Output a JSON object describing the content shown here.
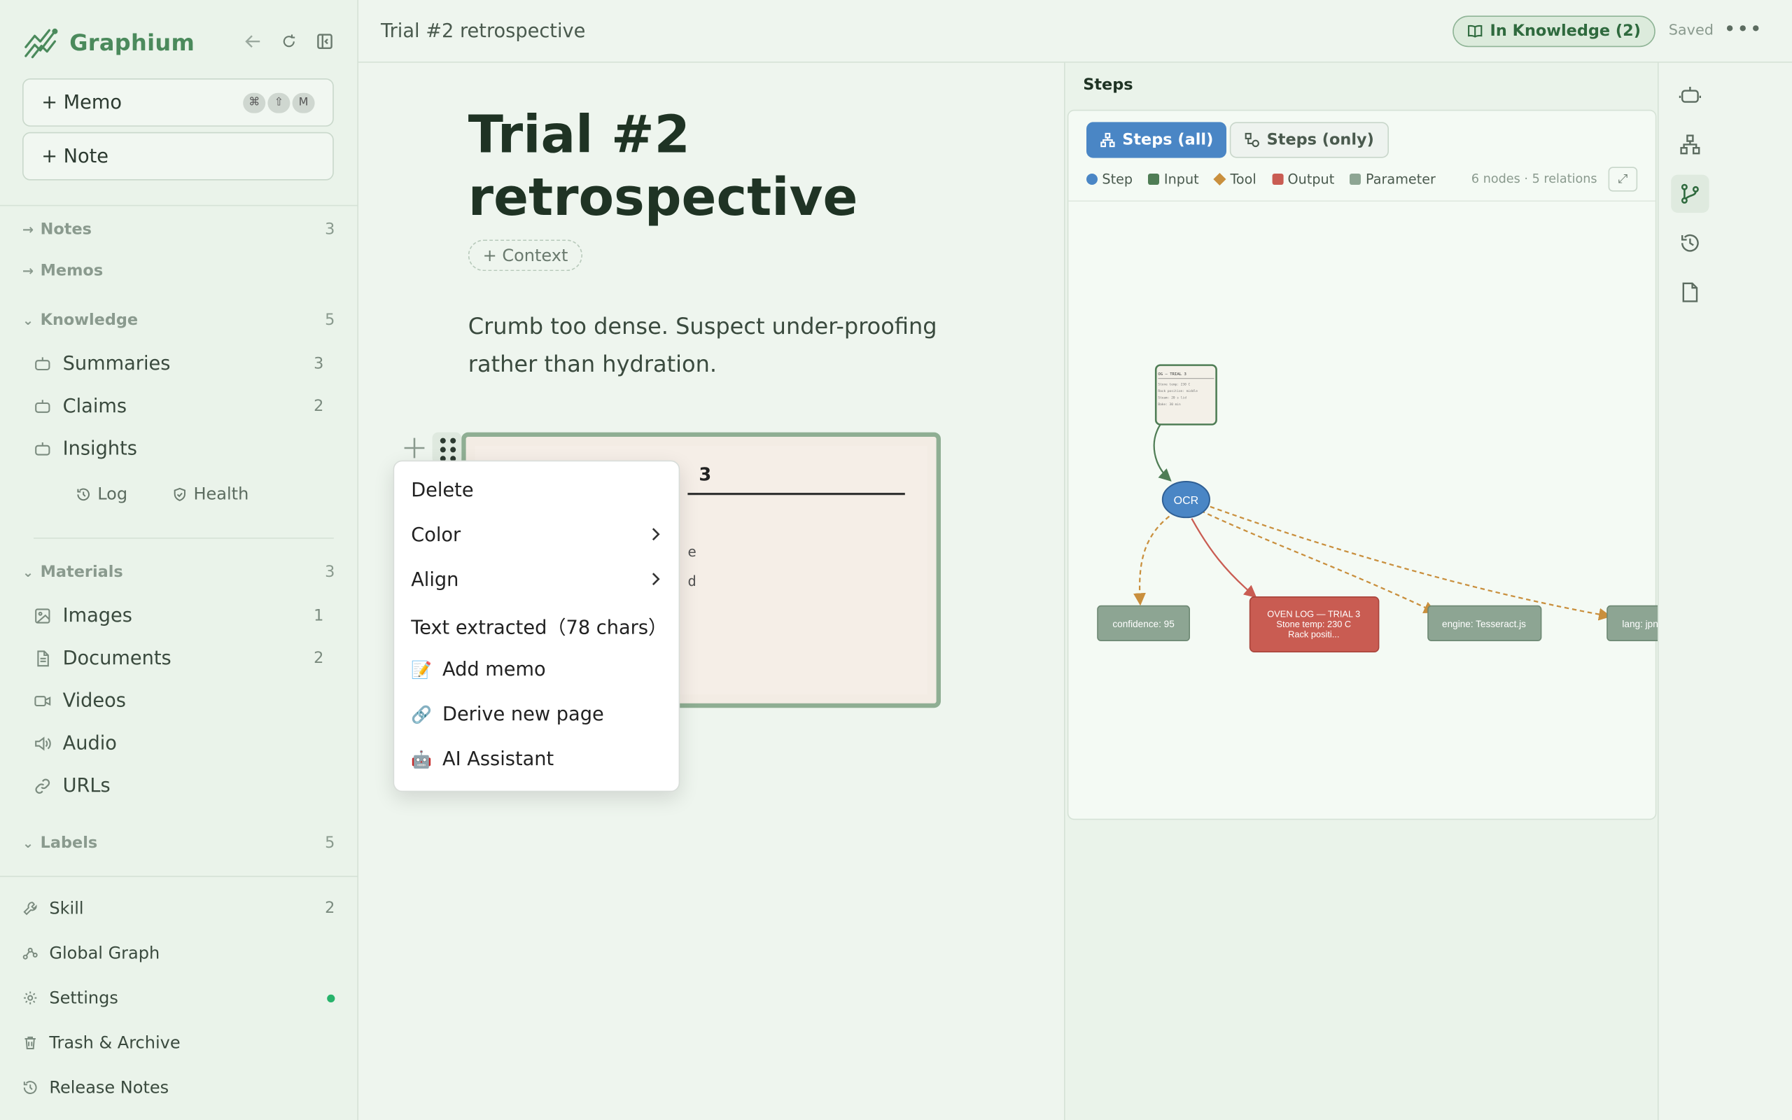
{
  "app": {
    "name": "Graphium"
  },
  "sidebar": {
    "create": [
      {
        "label": "+ Memo",
        "shortcut": [
          "⌘",
          "⇧",
          "M"
        ]
      },
      {
        "label": "+ Note"
      }
    ],
    "notes": {
      "label": "Notes",
      "count": "3"
    },
    "memos": {
      "label": "Memos"
    },
    "knowledge": {
      "label": "Knowledge",
      "count": "5",
      "items": [
        {
          "label": "Summaries",
          "count": "3"
        },
        {
          "label": "Claims",
          "count": "2"
        },
        {
          "label": "Insights",
          "count": ""
        }
      ],
      "sub": [
        {
          "label": "Log"
        },
        {
          "label": "Health"
        }
      ]
    },
    "materials": {
      "label": "Materials",
      "count": "3",
      "items": [
        {
          "label": "Images",
          "count": "1"
        },
        {
          "label": "Documents",
          "count": "2"
        },
        {
          "label": "Videos",
          "count": ""
        },
        {
          "label": "Audio",
          "count": ""
        },
        {
          "label": "URLs",
          "count": ""
        }
      ]
    },
    "labels": {
      "label": "Labels",
      "count": "5"
    },
    "footer": [
      {
        "label": "Skill",
        "count": "2"
      },
      {
        "label": "Global Graph",
        "count": ""
      },
      {
        "label": "Settings",
        "count": ""
      },
      {
        "label": "Trash & Archive",
        "count": ""
      },
      {
        "label": "Release Notes",
        "count": ""
      }
    ]
  },
  "topbar": {
    "crumb": "Trial #2 retrospective",
    "badge": "In Knowledge (2)",
    "saved": "Saved"
  },
  "editor": {
    "title": "Trial #2 retrospective",
    "context_button": "+ Context",
    "body": "Crumb too dense. Suspect under-proofing rather than hydration.",
    "image": {
      "heading": "3",
      "line1": "e",
      "line2": "d"
    },
    "menu": [
      {
        "label": "Delete",
        "emoji": "",
        "submenu": false
      },
      {
        "label": "Color",
        "emoji": "",
        "submenu": true
      },
      {
        "label": "Align",
        "emoji": "",
        "submenu": true
      },
      {
        "label": "Text extracted（78 chars）",
        "emoji": "",
        "submenu": false
      },
      {
        "label": "Add memo",
        "emoji": "📝",
        "submenu": false
      },
      {
        "label": "Derive new page",
        "emoji": "🔗",
        "submenu": false
      },
      {
        "label": "AI Assistant",
        "emoji": "🤖",
        "submenu": false
      }
    ]
  },
  "steps": {
    "title": "Steps",
    "tabs": [
      {
        "label": "Steps (all)"
      },
      {
        "label": "Steps (only)"
      }
    ],
    "legend": [
      {
        "label": "Step",
        "color": "#4a86c5",
        "shape": "circle"
      },
      {
        "label": "Input",
        "color": "#4f7d55",
        "shape": "square"
      },
      {
        "label": "Tool",
        "color": "#c98f3d",
        "shape": "diamond"
      },
      {
        "label": "Output",
        "color": "#c95c52",
        "shape": "square"
      },
      {
        "label": "Parameter",
        "color": "#8da593",
        "shape": "square"
      }
    ],
    "stats": "6 nodes · 5 relations",
    "expand": "⤢",
    "nodes": {
      "input_thumb": {
        "title": "OG — TRIAL 3",
        "lines": [
          "Stone temp: 230 C",
          "Rack position: middle",
          "Steam: 20 s lid",
          "Bake: 30 min"
        ]
      },
      "step": {
        "label": "OCR"
      },
      "confidence": {
        "label": "confidence: 95"
      },
      "output": {
        "lines": [
          "OVEN LOG — TRIAL 3",
          "Stone temp: 230 C",
          "Rack positi..."
        ]
      },
      "engine": {
        "label": "engine: Tesseract.js"
      },
      "lang": {
        "label": "lang: jpn+eng"
      }
    }
  },
  "colors": {
    "brand": "#4b8a5c",
    "step": "#4a86c5",
    "output": "#c95c52",
    "parameter": "#8da593",
    "tool_edge": "#c98f3d"
  }
}
